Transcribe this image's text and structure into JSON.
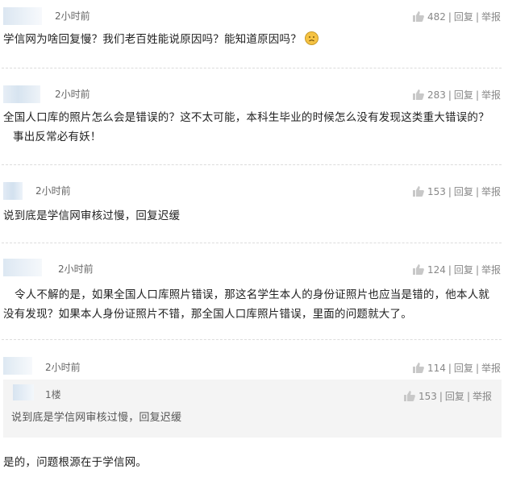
{
  "comments": [
    {
      "time": "2小时前",
      "likes": "482",
      "reply": "回复",
      "report": "举报",
      "text": "学信网为啥回复慢？我们老百姓能说原因吗？能知道原因吗？"
    },
    {
      "time": "2小时前",
      "likes": "283",
      "reply": "回复",
      "report": "举报",
      "text_line1": "全国人口库的照片怎么会是错误的？这不太可能，本科生毕业的时候怎么没有发现这类重大错误的？",
      "text_line2": "事出反常必有妖！"
    },
    {
      "time": "2小时前",
      "likes": "153",
      "reply": "回复",
      "report": "举报",
      "text": "说到底是学信网审核过慢，回复迟缓"
    },
    {
      "time": "2小时前",
      "likes": "124",
      "reply": "回复",
      "report": "举报",
      "text_line1": "令人不解的是，如果全国人口库照片错误，那这名学生本人的身份证照片也应当是错的，他本人就",
      "text_line2": "没有发现？如果本人身份证照片不错，那全国人口库照片错误，里面的问题就大了。"
    },
    {
      "time": "2小时前",
      "likes": "114",
      "reply": "回复",
      "report": "举报",
      "quote": {
        "floor": "1楼",
        "likes": "153",
        "reply": "回复",
        "report": "举报",
        "text": "说到底是学信网审核过慢，回复迟缓"
      },
      "text": "是的，问题根源在于学信网。"
    }
  ],
  "icons": {
    "thumb": "thumbs-up-icon",
    "emoji": "sad-face-emoji-icon"
  },
  "colors": {
    "text": "#222222",
    "meta": "#888888",
    "quote_bg": "#f4f4f4",
    "avatar": "#d9e6f2"
  }
}
